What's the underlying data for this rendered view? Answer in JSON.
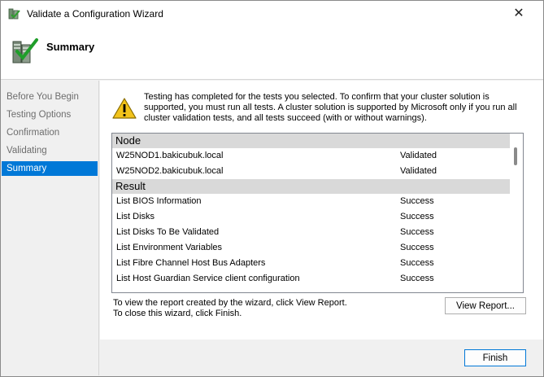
{
  "window": {
    "title": "Validate a Configuration Wizard",
    "close_glyph": "✕"
  },
  "header": {
    "title": "Summary"
  },
  "sidebar": {
    "items": [
      {
        "label": "Before You Begin"
      },
      {
        "label": "Testing Options"
      },
      {
        "label": "Confirmation"
      },
      {
        "label": "Validating"
      },
      {
        "label": "Summary"
      }
    ]
  },
  "message": {
    "text": "Testing has completed for the tests you selected. To confirm that your cluster solution is supported, you must run all tests.  A cluster solution is supported by Microsoft only if you run all cluster validation tests, and all tests succeed (with or without warnings)."
  },
  "results": {
    "node_header": "Node",
    "nodes": [
      {
        "name": "W25NOD1.bakicubuk.local",
        "status": "Validated"
      },
      {
        "name": "W25NOD2.bakicubuk.local",
        "status": "Validated"
      }
    ],
    "result_header": "Result",
    "tests": [
      {
        "name": "List BIOS Information",
        "status": "Success"
      },
      {
        "name": "List Disks",
        "status": "Success"
      },
      {
        "name": "List Disks To Be Validated",
        "status": "Success"
      },
      {
        "name": "List Environment Variables",
        "status": "Success"
      },
      {
        "name": "List Fibre Channel Host Bus Adapters",
        "status": "Success"
      },
      {
        "name": "List Host Guardian Service client configuration",
        "status": "Success"
      }
    ]
  },
  "report": {
    "line1": "To view the report created by the wizard, click View Report.",
    "line2": "To close this wizard, click Finish.",
    "view_report_label": "View Report..."
  },
  "footer": {
    "finish_label": "Finish"
  },
  "colors": {
    "accent": "#0078d7",
    "group_header": "#d9d9d9"
  }
}
